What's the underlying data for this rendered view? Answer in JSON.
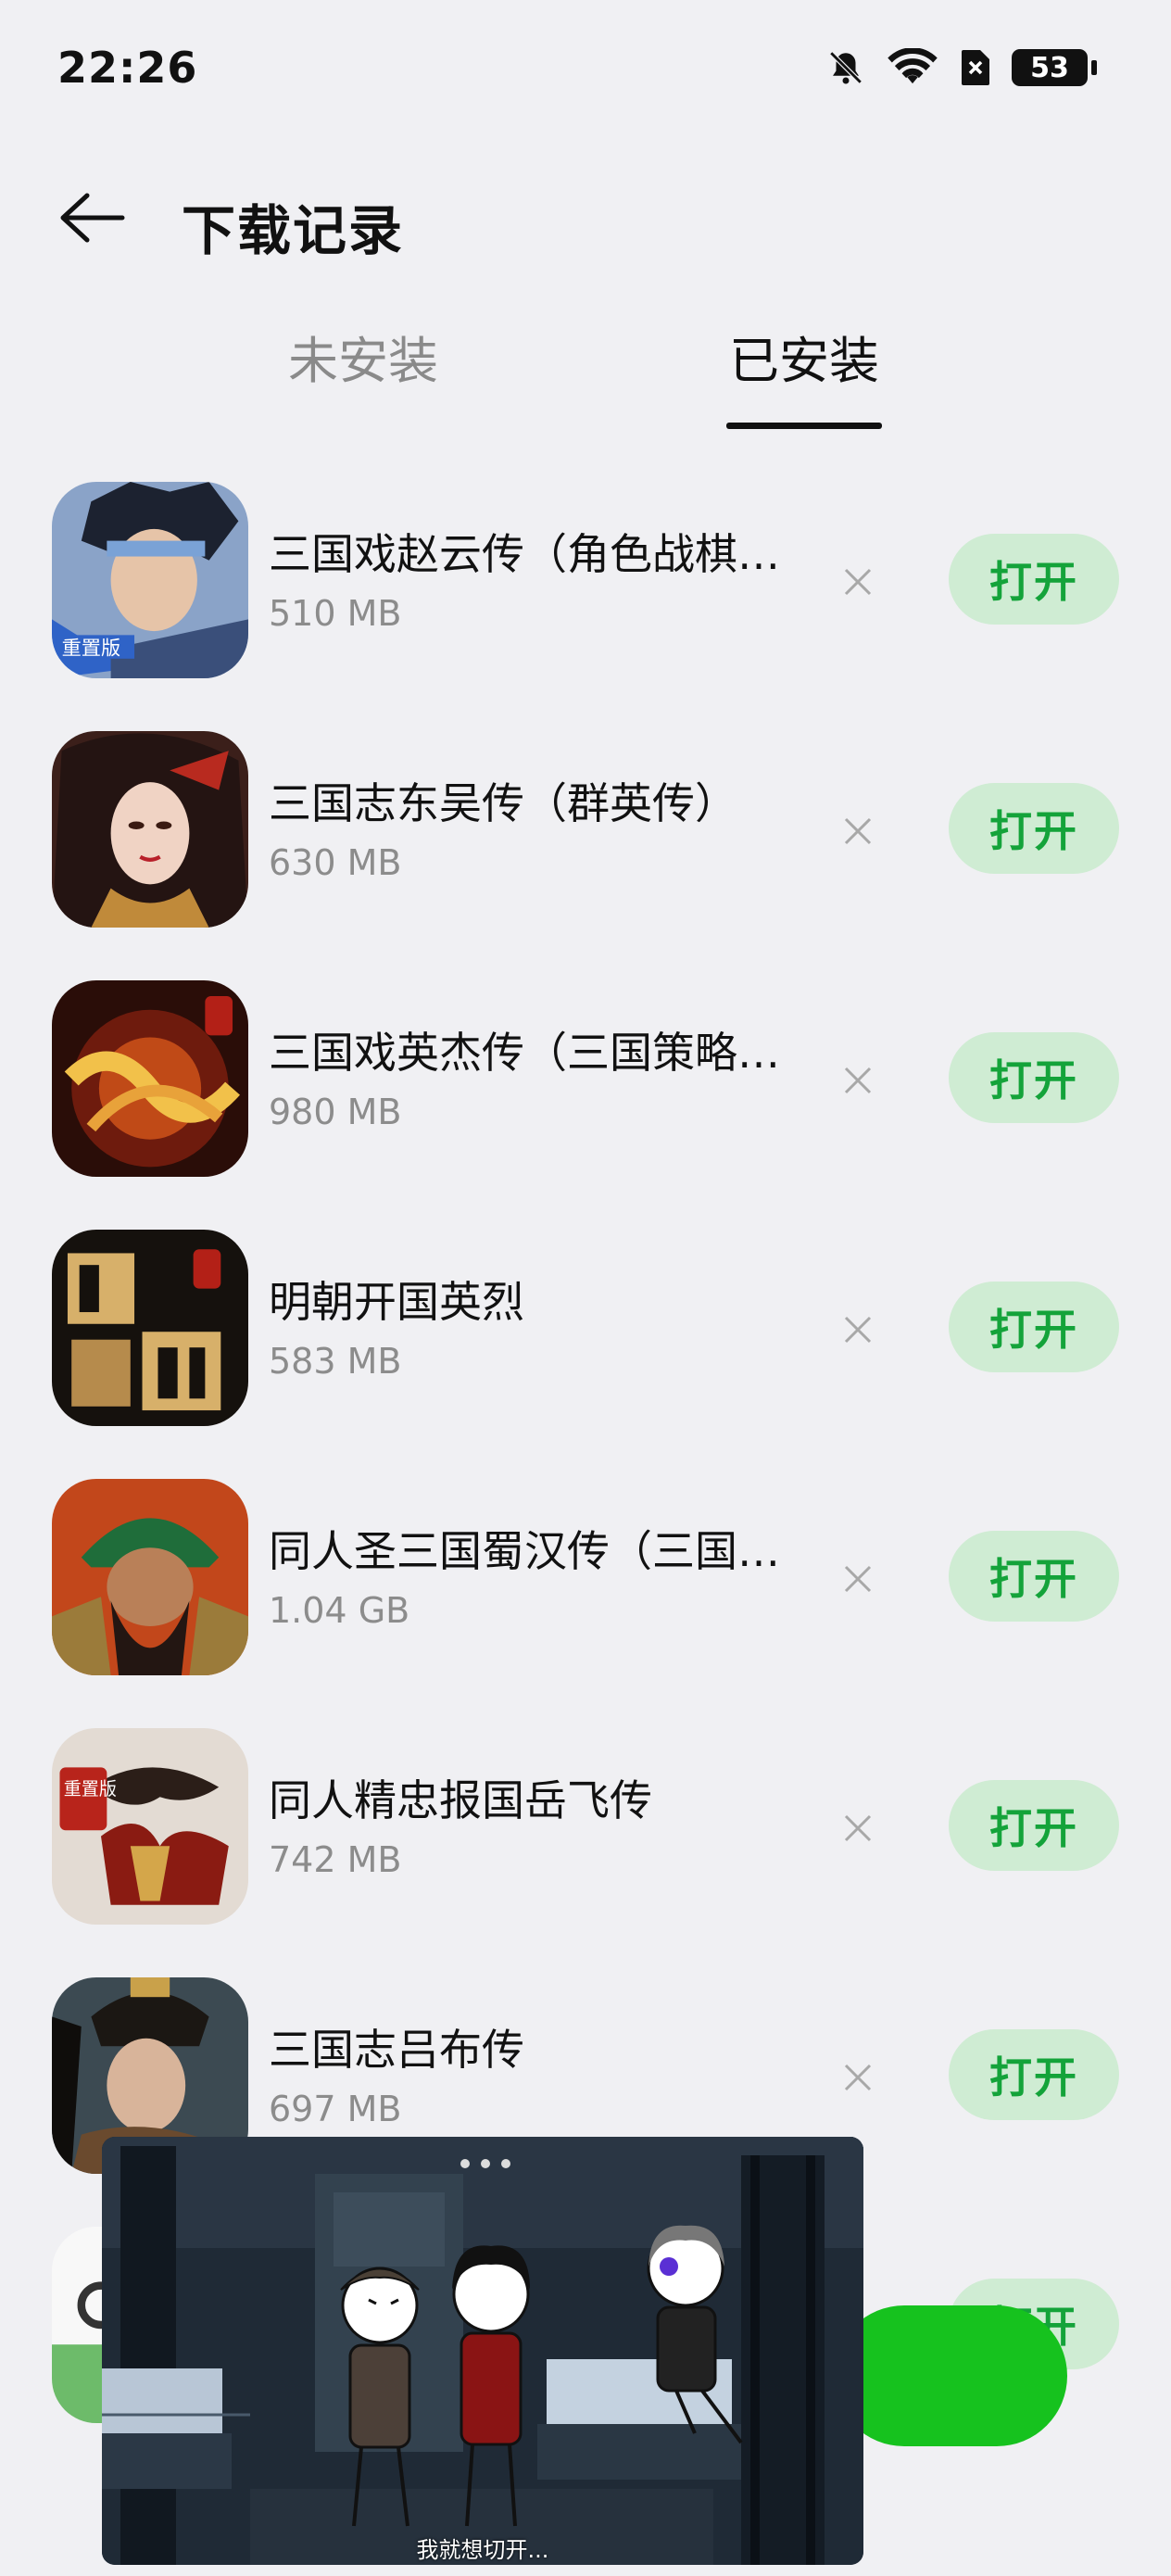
{
  "status_bar": {
    "time": "22:26",
    "icons": [
      "mute-bell-icon",
      "wifi-icon",
      "sim-error-icon",
      "battery-icon"
    ],
    "battery": "53"
  },
  "header": {
    "back_icon": "arrow-left-icon",
    "title": "下载记录"
  },
  "tabs": [
    {
      "label": "未安装",
      "active": false
    },
    {
      "label": "已安装",
      "active": true
    }
  ],
  "apps": [
    {
      "name": "三国戏赵云传（角色战棋…",
      "size": "510 MB",
      "open_label": "打开",
      "icon": "zhao-yun-icon",
      "badge": "重置版"
    },
    {
      "name": "三国志东吴传（群英传）",
      "size": "630 MB",
      "open_label": "打开",
      "icon": "heroine-portrait-icon"
    },
    {
      "name": "三国戏英杰传（三国策略…",
      "size": "980 MB",
      "open_label": "打开",
      "icon": "yingjie-logo-icon"
    },
    {
      "name": "明朝开国英烈",
      "size": "583 MB",
      "open_label": "打开",
      "icon": "ming-dynasty-icon"
    },
    {
      "name": "同人圣三国蜀汉传（三国…",
      "size": "1.04 GB",
      "open_label": "打开",
      "icon": "guan-yu-icon"
    },
    {
      "name": "同人精忠报国岳飞传",
      "size": "742 MB",
      "open_label": "打开",
      "icon": "yue-fei-icon",
      "badge": "重置版"
    },
    {
      "name": "三国志吕布传",
      "size": "697 MB",
      "open_label": "打开",
      "icon": "lu-bu-icon"
    }
  ],
  "partial_row": {
    "open_label": "打开"
  },
  "video": {
    "subtitle": "我就想切开..."
  },
  "colors": {
    "accent_green": "#14a33a",
    "open_button_bg": "#cfecd3",
    "fab_green": "#16c21e"
  }
}
